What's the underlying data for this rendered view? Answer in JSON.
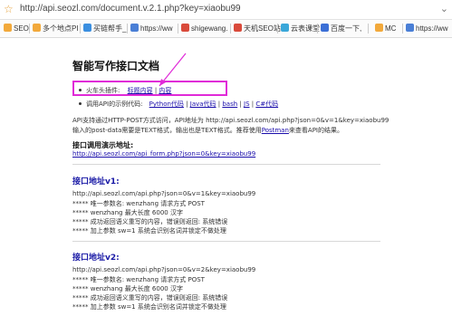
{
  "address_bar": {
    "url": "http://api.seozl.com/document.v.2.1.php?key=xiaobu99"
  },
  "bookmarks": [
    {
      "label": "SEO",
      "color": "#f2a93b"
    },
    {
      "label": "多个地点PI",
      "color": "#f2a93b"
    },
    {
      "label": "买链帮手_",
      "color": "#3b8fe0"
    },
    {
      "label": "https://ww",
      "color": "#4a7fd6"
    },
    {
      "label": "shigewang.",
      "color": "#d94a3b"
    },
    {
      "label": "天机SEO站",
      "color": "#d94a3b"
    },
    {
      "label": "云表课堂",
      "color": "#3aa7d9"
    },
    {
      "label": "百度一下,",
      "color": "#3b6fd6"
    },
    {
      "label": "MC",
      "color": "#f2a93b"
    },
    {
      "label": "https://ww",
      "color": "#4a7fd6"
    }
  ],
  "page": {
    "title": "智能写作接口文档",
    "plugins": {
      "label": "火车头插件:",
      "link1": "标题内容",
      "separator": "|",
      "link2": "内容"
    },
    "examples": {
      "label": "调用API的示例代码:",
      "links": [
        "Python代码",
        "Java代码",
        "bash",
        "JS",
        "C#代码"
      ]
    },
    "desc1": "API支持通过HTTP-POST方式访问，API地址为 http://api.seozl.com/api.php?json=0&v=1&key=xiaobu99",
    "desc2_pre": "输入的post-data需要是TEXT格式，输出也是TEXT格式。推荐使用",
    "desc2_link": "Postman",
    "desc2_post": "来查看API的结果。",
    "demo_heading": "接口调用演示地址:",
    "demo_link": "http://api.seozl.com/api_form.php?json=0&key=xiaobu99",
    "v1": {
      "heading": "接口地址v1:",
      "url": "http://api.seozl.com/api.php?json=0&v=1&key=xiaobu99",
      "lines": [
        "***** 唯一参数名: wenzhang 请求方式 POST",
        "***** wenzhang 最大长度 6000 汉字",
        "***** 成功返回语义重写的内容，错误则返回: 系统错误",
        "***** 加上参数 sw=1 系统会识别名词并锁定不做处理"
      ]
    },
    "v2": {
      "heading": "接口地址v2:",
      "url": "http://api.seozl.com/api.php?json=0&v=2&key=xiaobu99",
      "lines": [
        "***** 唯一参数名: wenzhang 请求方式 POST",
        "***** wenzhang 最大长度 6000 汉字",
        "***** 成功返回语义重写的内容，错误则返回: 系统错误",
        "***** 加上参数 sw=1 系统会识别名词并锁定不做处理"
      ]
    }
  },
  "colors": {
    "highlight": "#e02ad8",
    "link": "#1a0dab",
    "heading_blue": "#1a1aa6"
  }
}
